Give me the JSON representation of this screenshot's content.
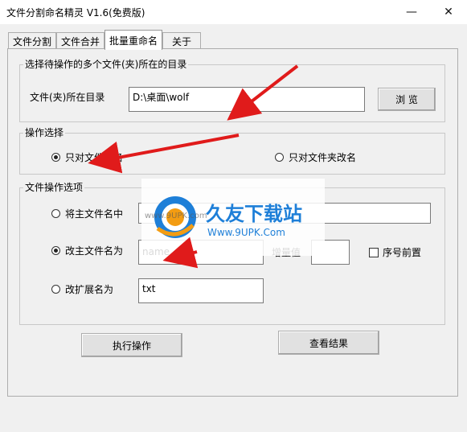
{
  "window": {
    "title": "文件分割命名精灵 V1.6(免费版)"
  },
  "window_controls": {
    "minimize": "—",
    "close": "✕"
  },
  "tabs": [
    "文件分割",
    "文件合并",
    "批量重命名",
    "关于"
  ],
  "active_tab": "批量重命名",
  "dir_group": {
    "label": "选择待操作的多个文件(夹)所在的目录",
    "field_label": "文件(夹)所在目录",
    "path_value": "D:\\桌面\\wolf",
    "browse_label": "浏 览"
  },
  "op_group": {
    "label": "操作选择",
    "option_files": "只对文件改名",
    "option_folders": "只对文件夹改名",
    "selected": "option_files"
  },
  "file_ops": {
    "label": "文件操作选项",
    "opt_replace_main": "将主文件名中",
    "opt_change_main": "改主文件名为",
    "opt_change_ext": "改扩展名为",
    "selected": "opt_change_main",
    "main_name_value": "name",
    "increment_label": "增量值",
    "seq_first_label": "序号前置",
    "ext_value": "txt"
  },
  "actions": {
    "execute_label": "执行操作",
    "view_result_label": "查看结果"
  },
  "watermark": {
    "brand": "久友下载站",
    "url": "Www.9UPK.Com",
    "site_frag": "www.9UPK.com"
  },
  "colors": {
    "arrow": "#e01b1b",
    "watermark_blue": "#1e7fd8",
    "watermark_orange": "#f39c12"
  }
}
